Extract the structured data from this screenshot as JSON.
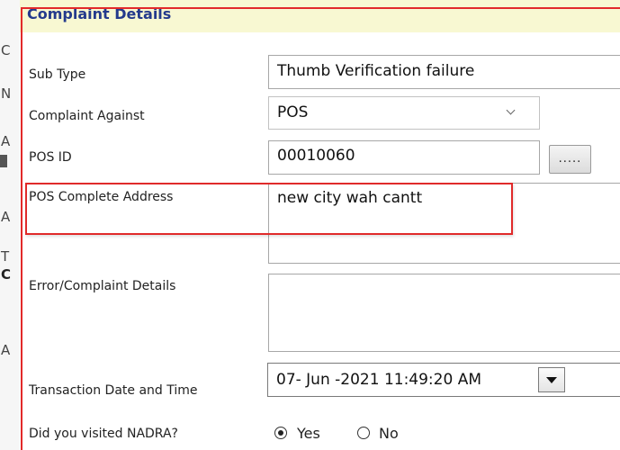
{
  "section": {
    "title": "Complaint Details"
  },
  "left_strip": {
    "glyphs": [
      "C",
      "N",
      "A",
      "A",
      "A",
      "T",
      "C",
      "A"
    ]
  },
  "form": {
    "sub_type": {
      "label": "Sub Type",
      "value": "Thumb Verification failure"
    },
    "complaint_against": {
      "label": "Complaint Against",
      "selected": "POS"
    },
    "pos_id": {
      "label": "POS ID",
      "value": "00010060",
      "lookup_button_label": "....."
    },
    "pos_address": {
      "label": "POS Complete Address",
      "value": "new city wah cantt"
    },
    "error_details": {
      "label": "Error/Complaint Details",
      "value": ""
    },
    "transaction_datetime": {
      "label": "Transaction Date and Time",
      "value": "07- Jun -2021 11:49:20 AM"
    },
    "visited_nadra": {
      "label": "Did you visited NADRA?",
      "options": [
        {
          "label": "Yes",
          "selected": true
        },
        {
          "label": "No",
          "selected": false
        }
      ]
    }
  },
  "colors": {
    "header_band": "#f8f8d2",
    "header_text": "#243a8c",
    "annotation_red": "#e22a2a",
    "field_border": "#a7a7a7"
  }
}
